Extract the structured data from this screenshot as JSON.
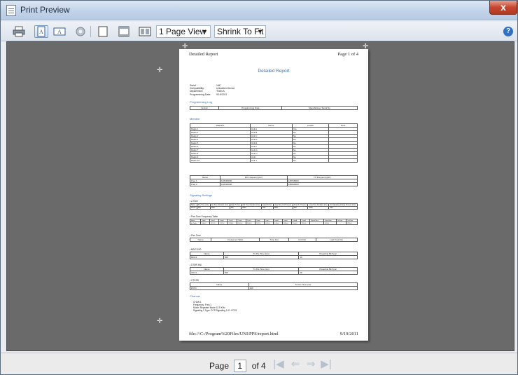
{
  "window": {
    "title": "Print Preview",
    "close_label": "x"
  },
  "toolbar": {
    "page_view": {
      "value": "1 Page View",
      "arrow": "▼"
    },
    "zoom": {
      "value": "Shrink To Fit",
      "arrow": "▼"
    },
    "help_label": "?"
  },
  "page": {
    "header_left": "Detailed Report",
    "header_right": "Page 1 of 4",
    "report_title": "Detailed Report",
    "info": [
      {
        "k": "Serial :",
        "v": "1AF"
      },
      {
        "k": "Compatibility:",
        "v": "Unication Device"
      },
      {
        "k": "Department:",
        "v": "Team A"
      },
      {
        "k": "Programming Date:",
        "v": "9/19/2011"
      }
    ],
    "sections": {
      "programming_log": "Programming Log",
      "member": "Member",
      "signaling": "Signaling Settings",
      "channel": "Channel"
    },
    "log_headers": [
      "Version",
      "Programming Date",
      "Manufacturer Serial No"
    ],
    "member_headers": [
      "RadioNo",
      "Name",
      "Leader",
      "Note"
    ],
    "members": [
      [
        "Radio 1",
        "Unit A",
        "Yes",
        ""
      ],
      [
        "Radio 2",
        "Unit B",
        "No",
        ""
      ],
      [
        "Radio 3",
        "Unit C",
        "No",
        ""
      ],
      [
        "Radio 4",
        "Unit D",
        "No",
        ""
      ],
      [
        "Radio 5",
        "Unit E",
        "No",
        ""
      ],
      [
        "Radio 6",
        "Unit F",
        "No",
        ""
      ],
      [
        "Radio 7",
        "Unit G",
        "No",
        ""
      ],
      [
        "Radio 8",
        "Unit H",
        "No",
        ""
      ],
      [
        "Radio 9",
        "Unit I",
        "No",
        ""
      ],
      [
        "Radio 10",
        "Unit J",
        "No",
        ""
      ]
    ],
    "freq_headers": [
      "Name",
      "RX Frequency(Hz)",
      "TX Frequency(Hz)"
    ],
    "freqs": [
      [
        "Freq 1",
        "148418000",
        "148718000"
      ],
      [
        "Freq 2",
        "148418000",
        "148418000"
      ]
    ],
    "bullets": {
      "b1": "2-Tone",
      "b2": "Five Tone Frequency Table",
      "b3": "Five Tone",
      "b4": "MDC1200",
      "b5": "DTMF ANI",
      "b6": "CTCSS"
    },
    "twotone_headers": [
      "Name",
      "Pre-Time (ms)",
      "1st Tone Duration (ms)",
      "Gap1 To Sel",
      "2nd Tone Duration (ms)",
      "Gap2 To Sel",
      "Long Tone Ind Timeout",
      "Tone Rx Timeout",
      "Long Tone Duration (ms)",
      "No Signaling Activity Timeout (ms)"
    ],
    "twotone_row": [
      "2Tone",
      "300",
      "1100",
      "300",
      "3000",
      "300",
      "3000",
      "300",
      "3000",
      "300"
    ],
    "fivefreq_headers": [
      "Name",
      "Tone0",
      "Tone1",
      "Tone2",
      "Tone3",
      "Tone4",
      "Tone5",
      "Tone6",
      "Tone7",
      "Tone8",
      "Tone9",
      "ToneA",
      "ToneB",
      "RepeatTone",
      "GroupTone",
      "NoTone",
      "UnitTone"
    ],
    "fivefreq_row": [
      "Ea Table",
      "1060.0",
      "1197.0",
      "1275.0",
      "1358.0",
      "1441.0",
      "1530.0",
      "1597.0",
      "1670.0",
      "1750.0",
      "1830.0",
      "1910.0",
      "2110.0",
      "",
      "1570.0",
      "",
      "2110.0",
      "2650.0"
    ],
    "fivetone_headers": [
      "Name",
      "Frequency Table",
      "Tone Dur",
      "Unit Dur",
      "Last Tone Dur"
    ],
    "mdc_headers": [
      "Name",
      "Tx Pre-Time (ms)",
      "Preamble Bit Sync"
    ],
    "mdc_row": [
      "MDC1",
      "500",
      "16"
    ],
    "dtmf_headers": [
      "Name",
      "Tx Pre-Time (ms)",
      "Preamble Bit Sync"
    ],
    "dtmf_row": [
      "UDC1",
      "500",
      "16"
    ],
    "ctcss_headers": [
      "Name",
      "Tx Pre-Time (ms)"
    ],
    "ctcss_row": [
      "PCS1",
      "100"
    ],
    "channel_lines": [
      "CHAN 1",
      "Frequency:          Freq 1",
      "Mode:                Repeater Mode              12.5 KHz",
      "Signaling 1 Type:   PCS        Signaling 1 ID:   PCS1"
    ],
    "footer_left": "file:///C:/Program%20Files/UNI/PPS/report.html",
    "footer_right": "9/19/2011"
  },
  "pager": {
    "label": "Page",
    "current": "1",
    "of_label": "of 4"
  }
}
